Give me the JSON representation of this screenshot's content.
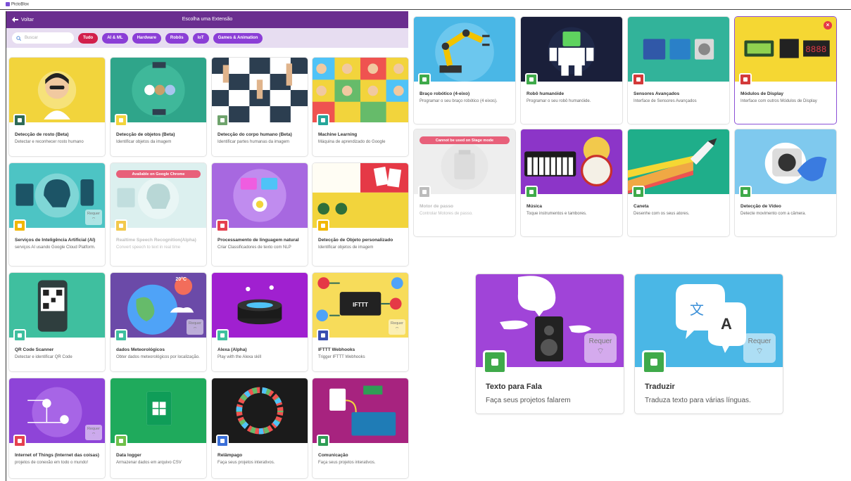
{
  "app": {
    "title": "PictoBlox"
  },
  "header": {
    "back_label": "Voltar",
    "title": "Escolha uma Extensão"
  },
  "filters": {
    "search_placeholder": "Buscar",
    "categories": [
      "Tudo",
      "AI & ML",
      "Hardware",
      "Robôs",
      "IoT",
      "Games & Animation"
    ],
    "selected": "Tudo"
  },
  "requires_label": "Requer",
  "left_cards": [
    {
      "title": "Detecção de rosto (Beta)",
      "desc": "Detectar e reconhecer rosto humano",
      "icon": "face-icon"
    },
    {
      "title": "Detecção de objetos (Beta)",
      "desc": "Identificar objetos da imagem",
      "icon": "cat-icon"
    },
    {
      "title": "Detecção do corpo humano (Beta)",
      "desc": "Identificar partes humanas da imagem",
      "icon": "hand-icon"
    },
    {
      "title": "Machine Learning",
      "desc": "Máquina de aprendizado do Google",
      "icon": "brain-icon"
    },
    {
      "title": "Serviços de Inteligência Artificial (AI)",
      "desc": "serviços AI usando Google Cloud Platform.",
      "icon": "ai-head-icon",
      "requires": true
    },
    {
      "title": "Realtime Speech Recognition(Alpha)",
      "desc": "Convert speech to text in real time",
      "icon": "speech-icon",
      "banner": "Available on Google Chrome",
      "disabled": true
    },
    {
      "title": "Processamento de linguagem natural",
      "desc": "Criar Classificadores de texto com NLP",
      "icon": "nlp-icon"
    },
    {
      "title": "Detecção de Objeto personalizado",
      "desc": "Identificar objetos de imagem",
      "icon": "target-icon"
    },
    {
      "title": "QR Code Scanner",
      "desc": "Detectar e identificar QR Code",
      "icon": "qr-icon"
    },
    {
      "title": "dados Meteorológicos",
      "desc": "Obter dados meteorológicos por localização.",
      "icon": "cloud-icon",
      "requires": true,
      "temp": "20°C"
    },
    {
      "title": "Alexa (Alpha)",
      "desc": "Play with the Alexa skill",
      "icon": "alexa-icon"
    },
    {
      "title": "IFTTT Webhooks",
      "desc": "Trigger IFTTT Webhooks",
      "icon": "ifttt-icon",
      "requires": true,
      "thumb_text": "IFTTT"
    },
    {
      "title": "Internet of Things (Internet das coisas)",
      "desc": "projetos de conexão em todo o mundo!",
      "icon": "iot-icon",
      "requires": true
    },
    {
      "title": "Data logger",
      "desc": "Armazenar dados em arquivo CSV",
      "icon": "sheet-icon"
    },
    {
      "title": "Relâmpago",
      "desc": "Faça seus projetos interativos.",
      "icon": "ring-icon"
    },
    {
      "title": "Comunicação",
      "desc": "Faça seus projetos interativos.",
      "icon": "serial-icon"
    }
  ],
  "right_cards": [
    {
      "title": "Braço robótico (4-eixo)",
      "desc": "Programar o seu braço robótico (4 eixos).",
      "icon": "robot-arm-icon"
    },
    {
      "title": "Robô humanóide",
      "desc": "Programar o seu robô humanóide.",
      "icon": "humanoid-icon"
    },
    {
      "title": "Sensores Avançados",
      "desc": "Interface de Sensores Avançados",
      "icon": "thermometer-icon"
    },
    {
      "title": "Módulos de Display",
      "desc": "Interface com outros Módulos de Display",
      "icon": "display-icon",
      "selected": true
    },
    {
      "title": "Motor de passo",
      "desc": "Controlar Motores de passo.",
      "icon": "stepper-icon",
      "banner": "Cannot be used on Stage mode",
      "disabled": true
    },
    {
      "title": "Música",
      "desc": "Toque instrumentos e tambores.",
      "icon": "music-icon"
    },
    {
      "title": "Caneta",
      "desc": "Desenhe com os seus atores.",
      "icon": "pen-icon"
    },
    {
      "title": "Detecção de Vídeo",
      "desc": "Detecte movimento com a câmera.",
      "icon": "video-icon"
    }
  ],
  "big_cards": [
    {
      "title": "Texto para Fala",
      "desc": "Faça seus projetos falarem",
      "icon": "speaker-icon",
      "requires": true
    },
    {
      "title": "Traduzir",
      "desc": "Traduza texto para várias línguas.",
      "icon": "translate-icon",
      "requires": true,
      "glyph_a": "A",
      "glyph_b": "文"
    }
  ],
  "colors": {
    "header": "#6a2e8f",
    "filter_bg": "#e7ddf1",
    "pill": "#8b3ed6",
    "pill_active": "#d21f4b",
    "selected_border": "#8b4fd6"
  }
}
